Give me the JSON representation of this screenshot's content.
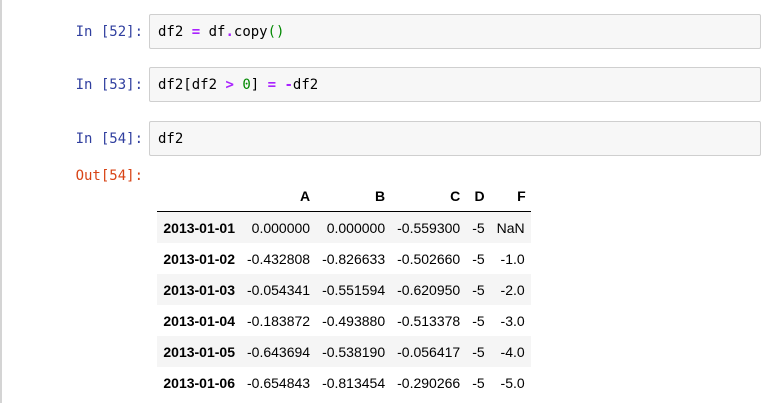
{
  "cells": [
    {
      "prompt": "In [52]:",
      "code_tokens": [
        {
          "text": "df2 ",
          "kind": "plain"
        },
        {
          "text": "=",
          "kind": "op"
        },
        {
          "text": " df",
          "kind": "plain"
        },
        {
          "text": ".",
          "kind": "op"
        },
        {
          "text": "copy",
          "kind": "plain"
        },
        {
          "text": "()",
          "kind": "paren"
        }
      ]
    },
    {
      "prompt": "In [53]:",
      "code_tokens": [
        {
          "text": "df2[df2 ",
          "kind": "plain"
        },
        {
          "text": ">",
          "kind": "op"
        },
        {
          "text": " ",
          "kind": "plain"
        },
        {
          "text": "0",
          "kind": "num"
        },
        {
          "text": "] ",
          "kind": "plain"
        },
        {
          "text": "=",
          "kind": "op"
        },
        {
          "text": " ",
          "kind": "plain"
        },
        {
          "text": "-",
          "kind": "op"
        },
        {
          "text": "df2",
          "kind": "plain"
        }
      ]
    },
    {
      "prompt": "In [54]:",
      "code_tokens": [
        {
          "text": "df2",
          "kind": "plain"
        }
      ]
    }
  ],
  "output": {
    "prompt": "Out[54]:",
    "columns": [
      "A",
      "B",
      "C",
      "D",
      "F"
    ],
    "rows": [
      {
        "index": "2013-01-01",
        "values": [
          "0.000000",
          "0.000000",
          "-0.559300",
          "-5",
          "NaN"
        ]
      },
      {
        "index": "2013-01-02",
        "values": [
          "-0.432808",
          "-0.826633",
          "-0.502660",
          "-5",
          "-1.0"
        ]
      },
      {
        "index": "2013-01-03",
        "values": [
          "-0.054341",
          "-0.551594",
          "-0.620950",
          "-5",
          "-2.0"
        ]
      },
      {
        "index": "2013-01-04",
        "values": [
          "-0.183872",
          "-0.493880",
          "-0.513378",
          "-5",
          "-3.0"
        ]
      },
      {
        "index": "2013-01-05",
        "values": [
          "-0.643694",
          "-0.538190",
          "-0.056417",
          "-5",
          "-4.0"
        ]
      },
      {
        "index": "2013-01-06",
        "values": [
          "-0.654843",
          "-0.813454",
          "-0.290266",
          "-5",
          "-5.0"
        ]
      }
    ]
  }
}
